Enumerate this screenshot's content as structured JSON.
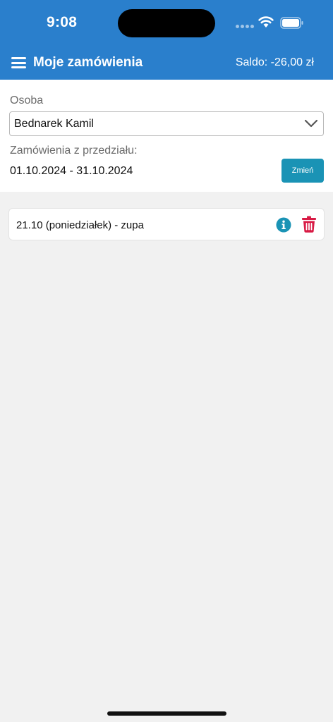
{
  "status_bar": {
    "time": "9:08",
    "icons": [
      "signal-dots-icon",
      "wifi-icon",
      "battery-icon"
    ]
  },
  "header": {
    "menu_icon": "hamburger-icon",
    "title": "Moje zamówienia",
    "balance": "Saldo: -26,00 zł"
  },
  "filters": {
    "person_label": "Osoba",
    "person_value": "Bednarek Kamil",
    "range_label": "Zamówienia z przedziału:",
    "range_value": "01.10.2024 - 31.10.2024",
    "change_button": "Zmień"
  },
  "orders": [
    {
      "label": "21.10 (poniedziałek) - zupa",
      "actions": [
        "info-icon",
        "trash-icon"
      ]
    }
  ],
  "colors": {
    "header": "#2a7fcc",
    "button": "#1a93b5",
    "info": "#1a93b5",
    "delete": "#d81b45",
    "background": "#f1f1f1"
  }
}
